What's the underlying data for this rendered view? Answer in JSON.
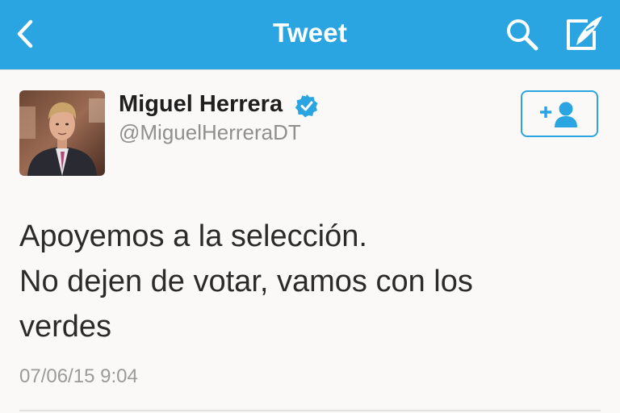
{
  "nav": {
    "title": "Tweet",
    "back_icon": "chevron-left-icon",
    "search_icon": "search-icon",
    "compose_icon": "compose-tweet-icon"
  },
  "tweet": {
    "author": {
      "display_name": "Miguel Herrera",
      "handle": "@MiguelHerreraDT",
      "verified": true,
      "avatar_icon": "profile-photo"
    },
    "follow_icon": "follow-user-icon",
    "text_lines": [
      "Apoyemos a la selección.",
      "No dejen de votar, vamos con los",
      "verdes"
    ],
    "timestamp": "07/06/15 9:04"
  },
  "colors": {
    "brand_blue": "#2aa5e2",
    "background": "#fbf9f8",
    "text": "#2b2b2b",
    "muted": "#8f8f8f"
  }
}
